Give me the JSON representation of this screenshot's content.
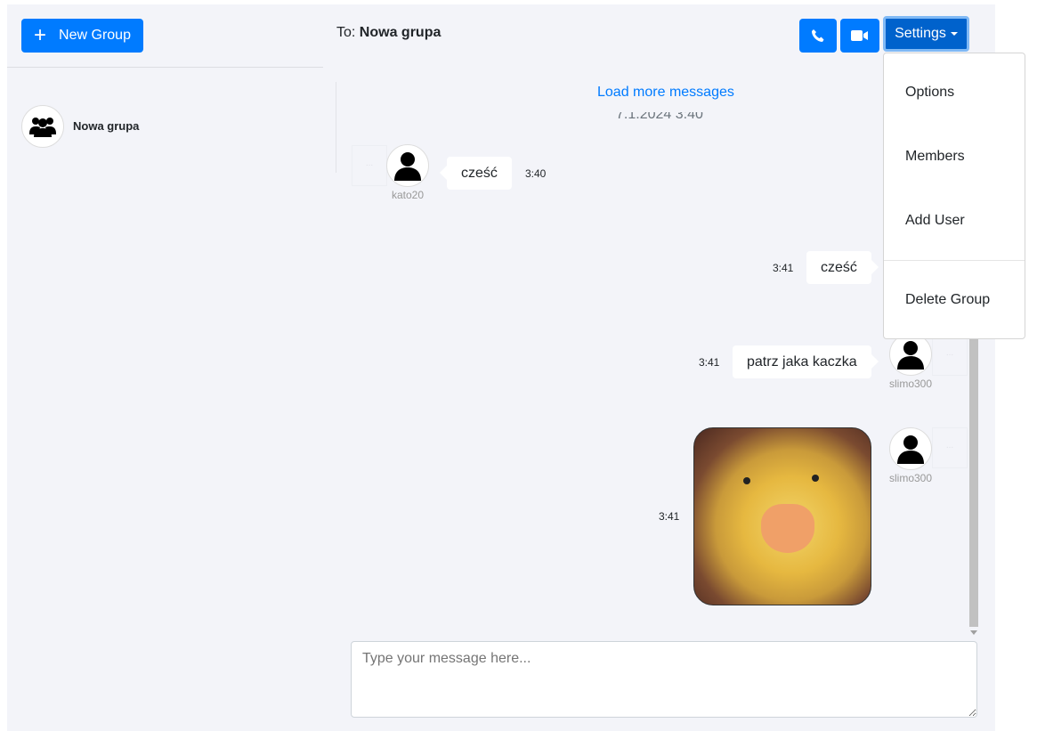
{
  "sidebar": {
    "new_group_label": "New Group",
    "groups": [
      {
        "name": "Nowa grupa",
        "icon": "users-icon"
      }
    ]
  },
  "header": {
    "to_label": "To:",
    "recipient": "Nowa grupa",
    "settings_label": "Settings",
    "call_icon": "phone-icon",
    "video_icon": "video-icon"
  },
  "settings_menu": {
    "items": [
      "Options",
      "Members",
      "Add User",
      "Delete Group"
    ]
  },
  "chat": {
    "load_more": "Load more messages",
    "date_separator": "7.1.2024 3:40",
    "messages": [
      {
        "user": "kato20",
        "text": "cześć",
        "time": "3:40",
        "side": "left"
      },
      {
        "user": "",
        "text": "cześć",
        "time": "3:41",
        "side": "right"
      },
      {
        "user": "slimo300",
        "text": "patrz jaka kaczka",
        "time": "3:41",
        "side": "right"
      },
      {
        "user": "slimo300",
        "text": "",
        "image": "duckling photo",
        "time": "3:41",
        "side": "right"
      }
    ],
    "more_label": "..."
  },
  "composer": {
    "placeholder": "Type your message here..."
  },
  "colors": {
    "primary": "#007bff",
    "settings_active": "#0062cc",
    "panel_bg": "#f3f4f9"
  }
}
